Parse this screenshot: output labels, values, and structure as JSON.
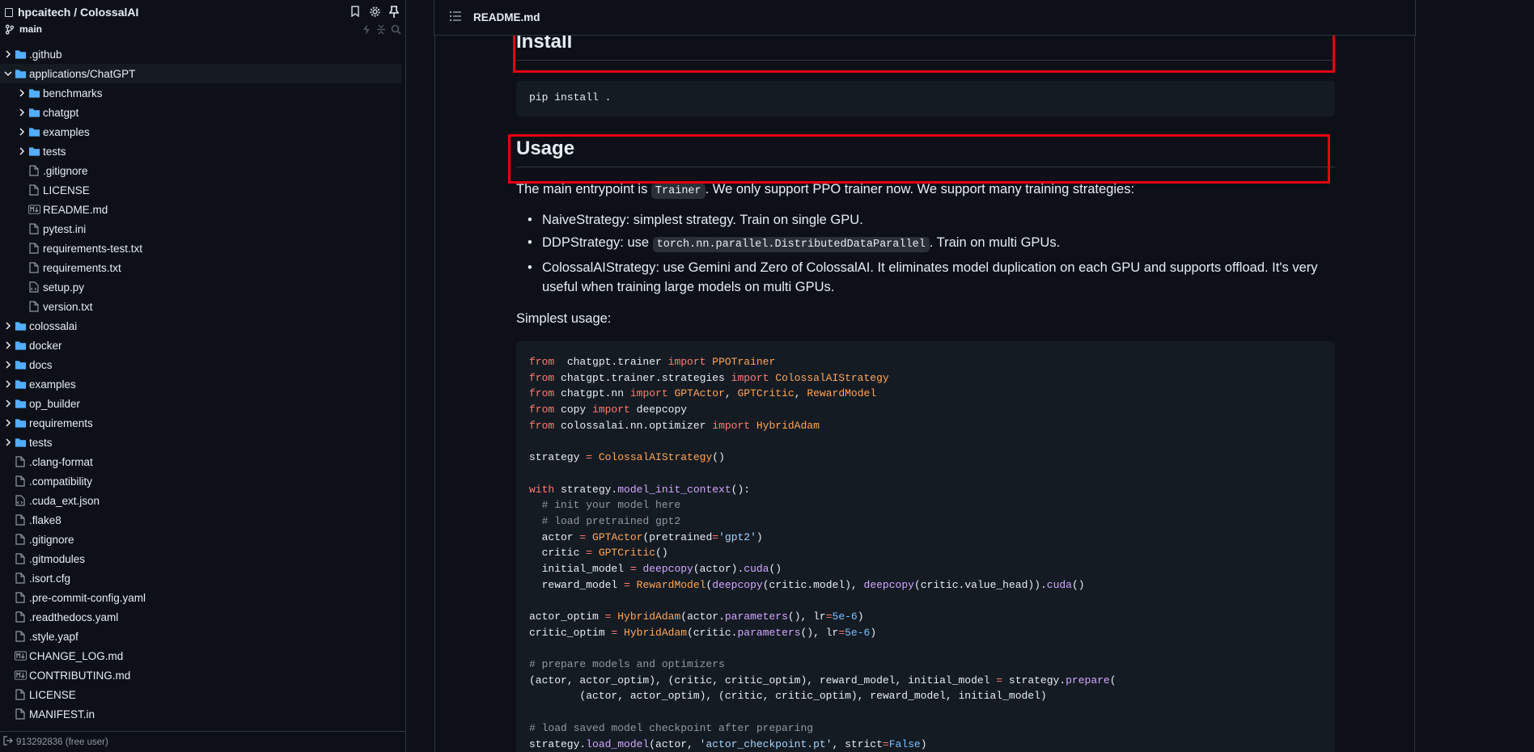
{
  "sidebar": {
    "repo": "hpcaitech / ColossalAI",
    "branch": "main",
    "tree": [
      {
        "label": ".github",
        "type": "folder",
        "level": 0,
        "expanded": false
      },
      {
        "label": "applications/ChatGPT",
        "type": "folder",
        "level": 0,
        "expanded": true,
        "selected": true
      },
      {
        "label": "benchmarks",
        "type": "folder",
        "level": 1,
        "expanded": false
      },
      {
        "label": "chatgpt",
        "type": "folder",
        "level": 1,
        "expanded": false
      },
      {
        "label": "examples",
        "type": "folder",
        "level": 1,
        "expanded": false
      },
      {
        "label": "tests",
        "type": "folder",
        "level": 1,
        "expanded": false
      },
      {
        "label": ".gitignore",
        "type": "file",
        "level": 1
      },
      {
        "label": "LICENSE",
        "type": "file",
        "level": 1
      },
      {
        "label": "README.md",
        "type": "md",
        "level": 1
      },
      {
        "label": "pytest.ini",
        "type": "file",
        "level": 1
      },
      {
        "label": "requirements-test.txt",
        "type": "file",
        "level": 1
      },
      {
        "label": "requirements.txt",
        "type": "file",
        "level": 1
      },
      {
        "label": "setup.py",
        "type": "code",
        "level": 1
      },
      {
        "label": "version.txt",
        "type": "file",
        "level": 1
      },
      {
        "label": "colossalai",
        "type": "folder",
        "level": 0,
        "expanded": false
      },
      {
        "label": "docker",
        "type": "folder",
        "level": 0,
        "expanded": false
      },
      {
        "label": "docs",
        "type": "folder",
        "level": 0,
        "expanded": false
      },
      {
        "label": "examples",
        "type": "folder",
        "level": 0,
        "expanded": false
      },
      {
        "label": "op_builder",
        "type": "folder",
        "level": 0,
        "expanded": false
      },
      {
        "label": "requirements",
        "type": "folder",
        "level": 0,
        "expanded": false
      },
      {
        "label": "tests",
        "type": "folder",
        "level": 0,
        "expanded": false
      },
      {
        "label": ".clang-format",
        "type": "file",
        "level": 0
      },
      {
        "label": ".compatibility",
        "type": "file",
        "level": 0
      },
      {
        "label": ".cuda_ext.json",
        "type": "code",
        "level": 0
      },
      {
        "label": ".flake8",
        "type": "file",
        "level": 0
      },
      {
        "label": ".gitignore",
        "type": "file",
        "level": 0
      },
      {
        "label": ".gitmodules",
        "type": "file",
        "level": 0
      },
      {
        "label": ".isort.cfg",
        "type": "file",
        "level": 0
      },
      {
        "label": ".pre-commit-config.yaml",
        "type": "file",
        "level": 0
      },
      {
        "label": ".readthedocs.yaml",
        "type": "file",
        "level": 0
      },
      {
        "label": ".style.yapf",
        "type": "file",
        "level": 0
      },
      {
        "label": "CHANGE_LOG.md",
        "type": "md",
        "level": 0
      },
      {
        "label": "CONTRIBUTING.md",
        "type": "md",
        "level": 0
      },
      {
        "label": "LICENSE",
        "type": "file",
        "level": 0
      },
      {
        "label": "MANIFEST.in",
        "type": "file",
        "level": 0
      }
    ],
    "footer": "913292836 (free user)"
  },
  "file_header": {
    "filename": "README.md"
  },
  "readme": {
    "install_heading": "Install",
    "install_code": "pip install .",
    "usage_heading": "Usage",
    "usage_intro_before": "The main entrypoint is ",
    "usage_intro_code": "Trainer",
    "usage_intro_after": ". We only support PPO trainer now. We support many training strategies:",
    "strategies": [
      {
        "before": "NaiveStrategy: simplest strategy. Train on single GPU.",
        "code": "",
        "after": ""
      },
      {
        "before": "DDPStrategy: use ",
        "code": "torch.nn.parallel.DistributedDataParallel",
        "after": ". Train on multi GPUs."
      },
      {
        "before": "ColossalAIStrategy: use Gemini and Zero of ColossalAI. It eliminates model duplication on each GPU and supports offload. It's very useful when training large models on multi GPUs.",
        "code": "",
        "after": ""
      }
    ],
    "simplest_usage": "Simplest usage:",
    "code_lines": [
      [
        [
          "kw",
          "from"
        ],
        [
          "",
          "  chatgpt.trainer "
        ],
        [
          "kw",
          "import"
        ],
        [
          "cls",
          " PPOTrainer"
        ]
      ],
      [
        [
          "kw",
          "from"
        ],
        [
          "",
          " chatgpt.trainer.strategies "
        ],
        [
          "kw",
          "import"
        ],
        [
          "cls",
          " ColossalAIStrategy"
        ]
      ],
      [
        [
          "kw",
          "from"
        ],
        [
          "",
          " chatgpt.nn "
        ],
        [
          "kw",
          "import"
        ],
        [
          "cls",
          " GPTActor"
        ],
        [
          "",
          ", "
        ],
        [
          "cls",
          "GPTCritic"
        ],
        [
          "",
          ", "
        ],
        [
          "cls",
          "RewardModel"
        ]
      ],
      [
        [
          "kw",
          "from"
        ],
        [
          "",
          " copy "
        ],
        [
          "kw",
          "import"
        ],
        [
          "",
          " deepcopy"
        ]
      ],
      [
        [
          "kw",
          "from"
        ],
        [
          "",
          " colossalai.nn.optimizer "
        ],
        [
          "kw",
          "import"
        ],
        [
          "cls",
          " HybridAdam"
        ]
      ],
      [],
      [
        [
          "",
          "strategy "
        ],
        [
          "op",
          "="
        ],
        [
          "cls",
          " ColossalAIStrategy"
        ],
        [
          "",
          "()"
        ]
      ],
      [],
      [
        [
          "kw",
          "with"
        ],
        [
          "",
          " strategy."
        ],
        [
          "fn",
          "model_init_context"
        ],
        [
          "",
          "():"
        ]
      ],
      [
        [
          "com",
          "  # init your model here"
        ]
      ],
      [
        [
          "com",
          "  # load pretrained gpt2"
        ]
      ],
      [
        [
          "",
          "  actor "
        ],
        [
          "op",
          "="
        ],
        [
          "cls",
          " GPTActor"
        ],
        [
          "",
          "(pretrained"
        ],
        [
          "op",
          "="
        ],
        [
          "str",
          "'gpt2'"
        ],
        [
          "",
          ")"
        ]
      ],
      [
        [
          "",
          "  critic "
        ],
        [
          "op",
          "="
        ],
        [
          "cls",
          " GPTCritic"
        ],
        [
          "",
          "()"
        ]
      ],
      [
        [
          "",
          "  initial_model "
        ],
        [
          "op",
          "="
        ],
        [
          "fn",
          " deepcopy"
        ],
        [
          "",
          "(actor)."
        ],
        [
          "fn",
          "cuda"
        ],
        [
          "",
          "()"
        ]
      ],
      [
        [
          "",
          "  reward_model "
        ],
        [
          "op",
          "="
        ],
        [
          "cls",
          " RewardModel"
        ],
        [
          "",
          "("
        ],
        [
          "fn",
          "deepcopy"
        ],
        [
          "",
          "(critic.model), "
        ],
        [
          "fn",
          "deepcopy"
        ],
        [
          "",
          "(critic.value_head))."
        ],
        [
          "fn",
          "cuda"
        ],
        [
          "",
          "()"
        ]
      ],
      [],
      [
        [
          "",
          "actor_optim "
        ],
        [
          "op",
          "="
        ],
        [
          "cls",
          " HybridAdam"
        ],
        [
          "",
          "(actor."
        ],
        [
          "fn",
          "parameters"
        ],
        [
          "",
          "(), lr"
        ],
        [
          "op",
          "="
        ],
        [
          "num",
          "5e-6"
        ],
        [
          "",
          ")"
        ]
      ],
      [
        [
          "",
          "critic_optim "
        ],
        [
          "op",
          "="
        ],
        [
          "cls",
          " HybridAdam"
        ],
        [
          "",
          "(critic."
        ],
        [
          "fn",
          "parameters"
        ],
        [
          "",
          "(), lr"
        ],
        [
          "op",
          "="
        ],
        [
          "num",
          "5e-6"
        ],
        [
          "",
          ")"
        ]
      ],
      [],
      [
        [
          "com",
          "# prepare models and optimizers"
        ]
      ],
      [
        [
          "",
          "(actor, actor_optim), (critic, critic_optim), reward_model, initial_model "
        ],
        [
          "op",
          "="
        ],
        [
          "",
          " strategy."
        ],
        [
          "fn",
          "prepare"
        ],
        [
          "",
          "("
        ]
      ],
      [
        [
          "",
          "        (actor, actor_optim), (critic, critic_optim), reward_model, initial_model)"
        ]
      ],
      [],
      [
        [
          "com",
          "# load saved model checkpoint after preparing"
        ]
      ],
      [
        [
          "",
          "strategy."
        ],
        [
          "fn",
          "load_model"
        ],
        [
          "",
          "(actor, "
        ],
        [
          "str",
          "'actor_checkpoint.pt'"
        ],
        [
          "",
          ", strict"
        ],
        [
          "op",
          "="
        ],
        [
          "num",
          "False"
        ],
        [
          "",
          ")"
        ]
      ]
    ]
  },
  "colors": {
    "highlight": "#e60012",
    "bg": "#0d1117",
    "folder": "#7d8590"
  }
}
